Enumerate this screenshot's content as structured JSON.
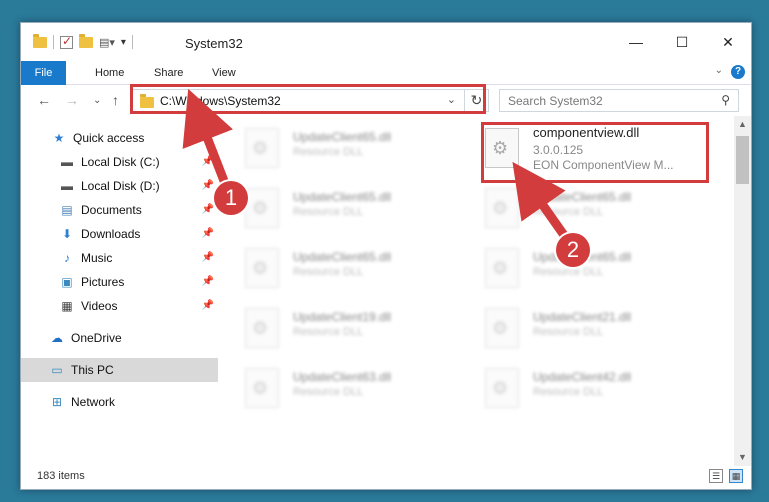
{
  "window": {
    "title": "System32"
  },
  "ribbon": {
    "tabs": [
      "File",
      "Home",
      "Share",
      "View"
    ],
    "help": "?"
  },
  "nav": {
    "address": "C:\\Windows\\System32",
    "search_placeholder": "Search System32"
  },
  "sidebar": {
    "items": [
      {
        "label": "Quick access",
        "icon": "star-icon"
      },
      {
        "label": "Local Disk (C:)",
        "icon": "drive-icon"
      },
      {
        "label": "Local Disk (D:)",
        "icon": "drive-icon"
      },
      {
        "label": "Documents",
        "icon": "documents-icon"
      },
      {
        "label": "Downloads",
        "icon": "download-icon"
      },
      {
        "label": "Music",
        "icon": "music-icon"
      },
      {
        "label": "Pictures",
        "icon": "pictures-icon"
      },
      {
        "label": "Videos",
        "icon": "videos-icon"
      },
      {
        "label": "OneDrive",
        "icon": "cloud-icon"
      },
      {
        "label": "This PC",
        "icon": "computer-icon"
      },
      {
        "label": "Network",
        "icon": "network-icon"
      }
    ]
  },
  "files": {
    "highlighted": {
      "name": "componentview.dll",
      "version": "3.0.0.125",
      "description": "EON ComponentView M..."
    },
    "blurred_left": [
      {
        "name": "UpdateClient65.dll",
        "type": "Resource DLL"
      },
      {
        "name": "UpdateClient65.dll",
        "type": "Resource DLL"
      },
      {
        "name": "UpdateClient65.dll",
        "type": "Resource DLL"
      },
      {
        "name": "UpdateClient19.dll",
        "type": "Resource DLL"
      },
      {
        "name": "UpdateClient63.dll",
        "type": "Resource DLL"
      }
    ],
    "blurred_right": [
      {
        "name": "UpdateClient65.dll",
        "type": "Resource DLL"
      },
      {
        "name": "UpdateClient65.dll",
        "type": "Resource DLL"
      },
      {
        "name": "UpdateClient21.dll",
        "type": "Resource DLL"
      },
      {
        "name": "UpdateClient42.dll",
        "type": "Resource DLL"
      }
    ]
  },
  "status": {
    "item_count": "183 items"
  },
  "callouts": [
    "1",
    "2"
  ],
  "colors": {
    "accent": "#1979ca",
    "highlight": "#d23c3c"
  }
}
